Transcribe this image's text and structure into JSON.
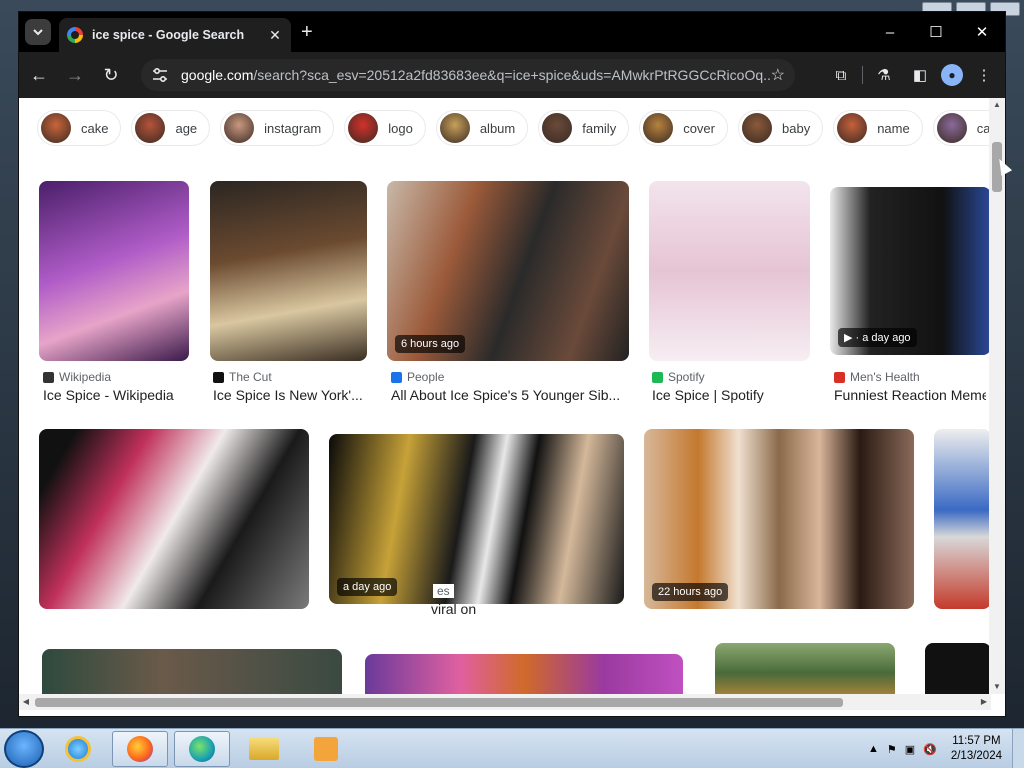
{
  "tab": {
    "title": "ice spice - Google Search",
    "close_icon": "close-icon",
    "new_tab_icon": "plus-icon"
  },
  "window": {
    "minimize": "–",
    "maximize": "☐",
    "close": "✕"
  },
  "toolbar": {
    "back": "back-arrow-icon",
    "forward": "forward-arrow-icon",
    "reload": "reload-icon",
    "url_domain": "google.com",
    "url_rest": "/search?sca_esv=20512a2fd83683ee&q=ice+spice&uds=AMwkrPtRGGCcRicoOq...",
    "star": "☆"
  },
  "chips": [
    {
      "label": "cake",
      "color": "#c9653a"
    },
    {
      "label": "age",
      "color": "#b5533a"
    },
    {
      "label": "instagram",
      "color": "#c99880"
    },
    {
      "label": "logo",
      "color": "#d3312b"
    },
    {
      "label": "album",
      "color": "#c7a05a"
    },
    {
      "label": "family",
      "color": "#6a4a3a"
    },
    {
      "label": "cover",
      "color": "#b7823e"
    },
    {
      "label": "baby",
      "color": "#8a5a3a"
    },
    {
      "label": "name",
      "color": "#c6603c"
    },
    {
      "label": "card",
      "color": "#8a6a9a"
    }
  ],
  "row1": [
    {
      "source": "Wikipedia",
      "caption": "Ice Spice - Wikipedia",
      "badge": "",
      "src_color": "#333"
    },
    {
      "source": "The Cut",
      "caption": "Ice Spice Is New York'...",
      "badge": "",
      "src_color": "#111"
    },
    {
      "source": "People",
      "caption": "All About Ice Spice's 5 Younger Sib...",
      "badge": "6 hours ago",
      "src_color": "#1a73e8"
    },
    {
      "source": "Spotify",
      "caption": "Ice Spice | Spotify",
      "badge": "",
      "src_color": "#1db954"
    },
    {
      "source": "Men's Health",
      "caption": "Funniest Reaction Meme",
      "badge": "▶ · a day ago",
      "src_color": "#d93025"
    }
  ],
  "row2": [
    {
      "badge": ""
    },
    {
      "badge": "a day ago",
      "caption_fragment": "es",
      "caption_fragment2": "viral on"
    },
    {
      "badge": "22 hours ago"
    },
    {
      "badge": ""
    }
  ],
  "taskbar": {
    "time": "11:57 PM",
    "date": "2/13/2024"
  },
  "colors": {
    "chrome_dark": "#1f1f1f",
    "tab_bar": "#000000",
    "accent": "#8ab4f8"
  }
}
